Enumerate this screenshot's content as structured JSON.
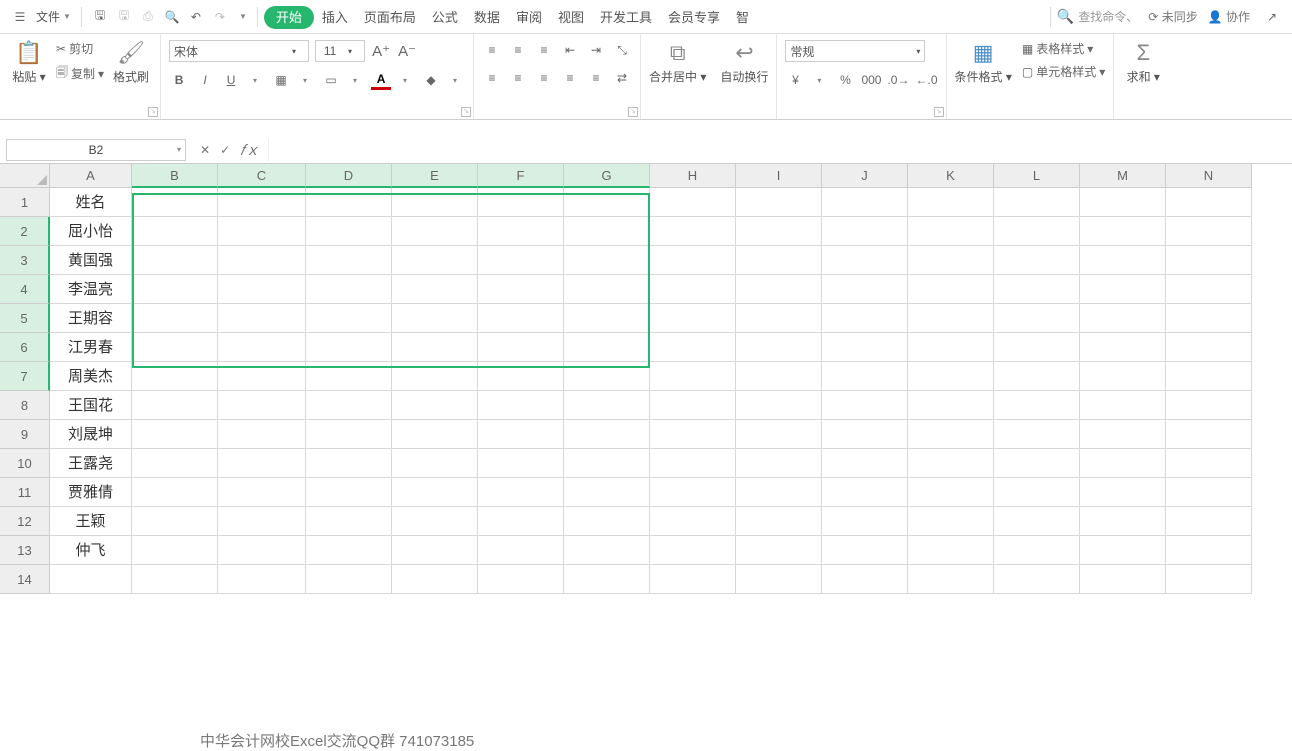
{
  "topbar": {
    "file": "文件",
    "tabs": [
      "开始",
      "插入",
      "页面布局",
      "公式",
      "数据",
      "审阅",
      "视图",
      "开发工具",
      "会员专享",
      "智"
    ],
    "active_tab": 0,
    "search_placeholder": "查找命令、",
    "sync": "未同步",
    "collab": "协作"
  },
  "ribbon": {
    "paste": "粘贴",
    "cut": "剪切",
    "copy": "复制",
    "brush": "格式刷",
    "font_name": "宋体",
    "font_size": "11",
    "merge": "合并居中",
    "wrap": "自动换行",
    "num_format": "常规",
    "cond": "条件格式",
    "table_style": "表格样式",
    "cell_style": "单元格样式",
    "sum": "求和"
  },
  "name_box": "B2",
  "columns": [
    "A",
    "B",
    "C",
    "D",
    "E",
    "F",
    "G",
    "H",
    "I",
    "J",
    "K",
    "L",
    "M",
    "N"
  ],
  "sel_cols": [
    "B",
    "C",
    "D",
    "E",
    "F",
    "G"
  ],
  "rows": [
    {
      "n": 1,
      "a": "姓名"
    },
    {
      "n": 2,
      "a": "屈小怡",
      "sel": true
    },
    {
      "n": 3,
      "a": "黄国强",
      "sel": true
    },
    {
      "n": 4,
      "a": "李温亮",
      "sel": true
    },
    {
      "n": 5,
      "a": "王期容",
      "sel": true
    },
    {
      "n": 6,
      "a": "江男春",
      "sel": true
    },
    {
      "n": 7,
      "a": "周美杰",
      "sel": true
    },
    {
      "n": 8,
      "a": "王国花"
    },
    {
      "n": 9,
      "a": "刘晟坤"
    },
    {
      "n": 10,
      "a": "王露尧"
    },
    {
      "n": 11,
      "a": "贾雅倩"
    },
    {
      "n": 12,
      "a": "王颖"
    },
    {
      "n": 13,
      "a": "仲飞"
    },
    {
      "n": 14,
      "a": ""
    }
  ],
  "watermark": "中华会计网校Excel交流QQ群  741073185"
}
